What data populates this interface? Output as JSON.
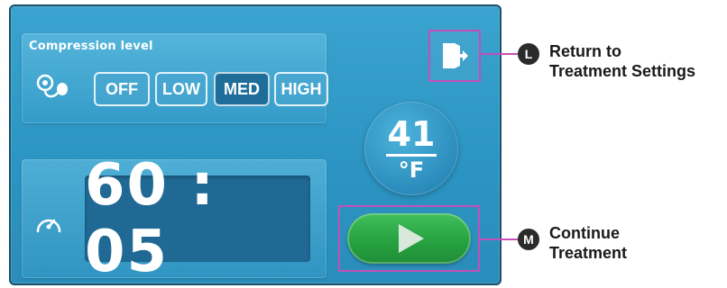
{
  "compression": {
    "title": "Compression level",
    "levels": [
      "OFF",
      "LOW",
      "MED",
      "HIGH"
    ],
    "selected": "MED"
  },
  "timer": {
    "value": "60 : 05"
  },
  "temperature": {
    "value": "41",
    "unit": "°F"
  },
  "callouts": {
    "L": {
      "badge": "L",
      "line1": "Return to",
      "line2": "Treatment Settings"
    },
    "M": {
      "badge": "M",
      "line1": "Continue",
      "line2": "Treatment"
    }
  },
  "colors": {
    "screen_bg": "#2c95c3",
    "active_level": "#1f6e99",
    "timer_bg": "#1f6994",
    "play_green": "#26a040",
    "callout_magenta": "#c44fb8"
  },
  "icons": {
    "compression": "cuff-bulb-icon",
    "timer": "speedometer-icon",
    "exit": "exit-door-icon",
    "play": "play-icon"
  }
}
